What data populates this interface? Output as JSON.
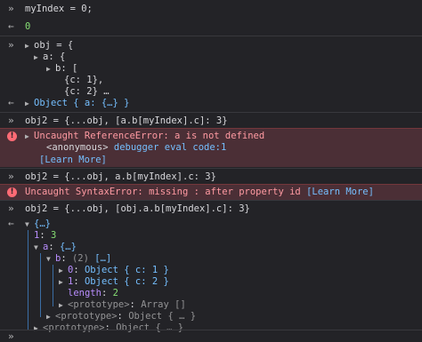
{
  "console": {
    "input_prompt": "»",
    "output_arrow": "←",
    "cmd1": "myIndex = 0;",
    "out1": "0",
    "cmd2": {
      "l1": "obj = {",
      "l2": "a: {",
      "l3": "b: [",
      "l4": "{c: 1},",
      "l5": "{c: 2} …"
    },
    "out2": "Object { a: {…} }",
    "cmd3": "obj2 = {...obj, [a.b[myIndex].c]: 3}",
    "err3": {
      "title": "Uncaught ReferenceError: a is not defined",
      "frame_name": "<anonymous>",
      "frame_loc": "debugger eval code:1",
      "learn_more": "[Learn More]"
    },
    "cmd4": "obj2 = {...obj, a.b[myIndex].c: 3}",
    "err4": {
      "title": "Uncaught SyntaxError: missing : after property id",
      "learn_more": "[Learn More]"
    },
    "cmd5": "obj2 = {...obj, [obj.a.b[myIndex].c]: 3}",
    "tree": {
      "root": "{…}",
      "k1": "1",
      "v1": "3",
      "k_a": "a",
      "v_a": "{…}",
      "k_b": "b",
      "v_b_count": "(2)",
      "v_b": "[…]",
      "k_0": "0",
      "v_0": "Object { c: 1 }",
      "k_1": "1",
      "v_1": "Object { c: 2 }",
      "k_len": "length",
      "v_len": "2",
      "proto_arr": "<prototype>",
      "proto_arr_v": "Array []",
      "proto_obj_a": "<prototype>",
      "proto_obj_a_v": "Object { … }",
      "proto_obj_root": "<prototype>",
      "proto_obj_root_v": "Object { … }"
    },
    "input_line": ""
  }
}
